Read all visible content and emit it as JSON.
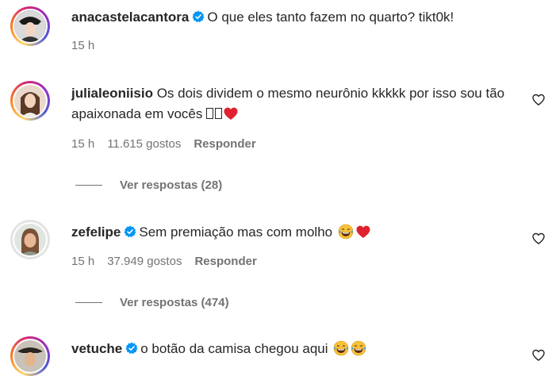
{
  "comments": [
    {
      "username": "anacastelacantora",
      "verified": true,
      "text": "O que eles tanto fazem no quarto? tikt0k!",
      "time": "15 h"
    },
    {
      "username": "julialeoniisio",
      "verified": false,
      "text": "Os dois dividem o mesmo neurônio kkkkk por isso sou tão apaixonada em vocês",
      "time": "15 h",
      "likes": "11.615 gostos",
      "reply_label": "Responder",
      "view_replies": "Ver respostas (28)"
    },
    {
      "username": "zefelipe",
      "verified": true,
      "text": "Sem premiação mas com molho",
      "time": "15 h",
      "likes": "37.949 gostos",
      "reply_label": "Responder",
      "view_replies": "Ver respostas (474)"
    },
    {
      "username": "vetuche",
      "verified": true,
      "text": "o botão da camisa chegou aqui"
    }
  ],
  "colors": {
    "verified": "#0095f6",
    "heart": "#ed4956",
    "secondary_text": "#737373"
  },
  "icons": {
    "like": "heart-outline-icon",
    "verified": "verified-badge-icon"
  }
}
